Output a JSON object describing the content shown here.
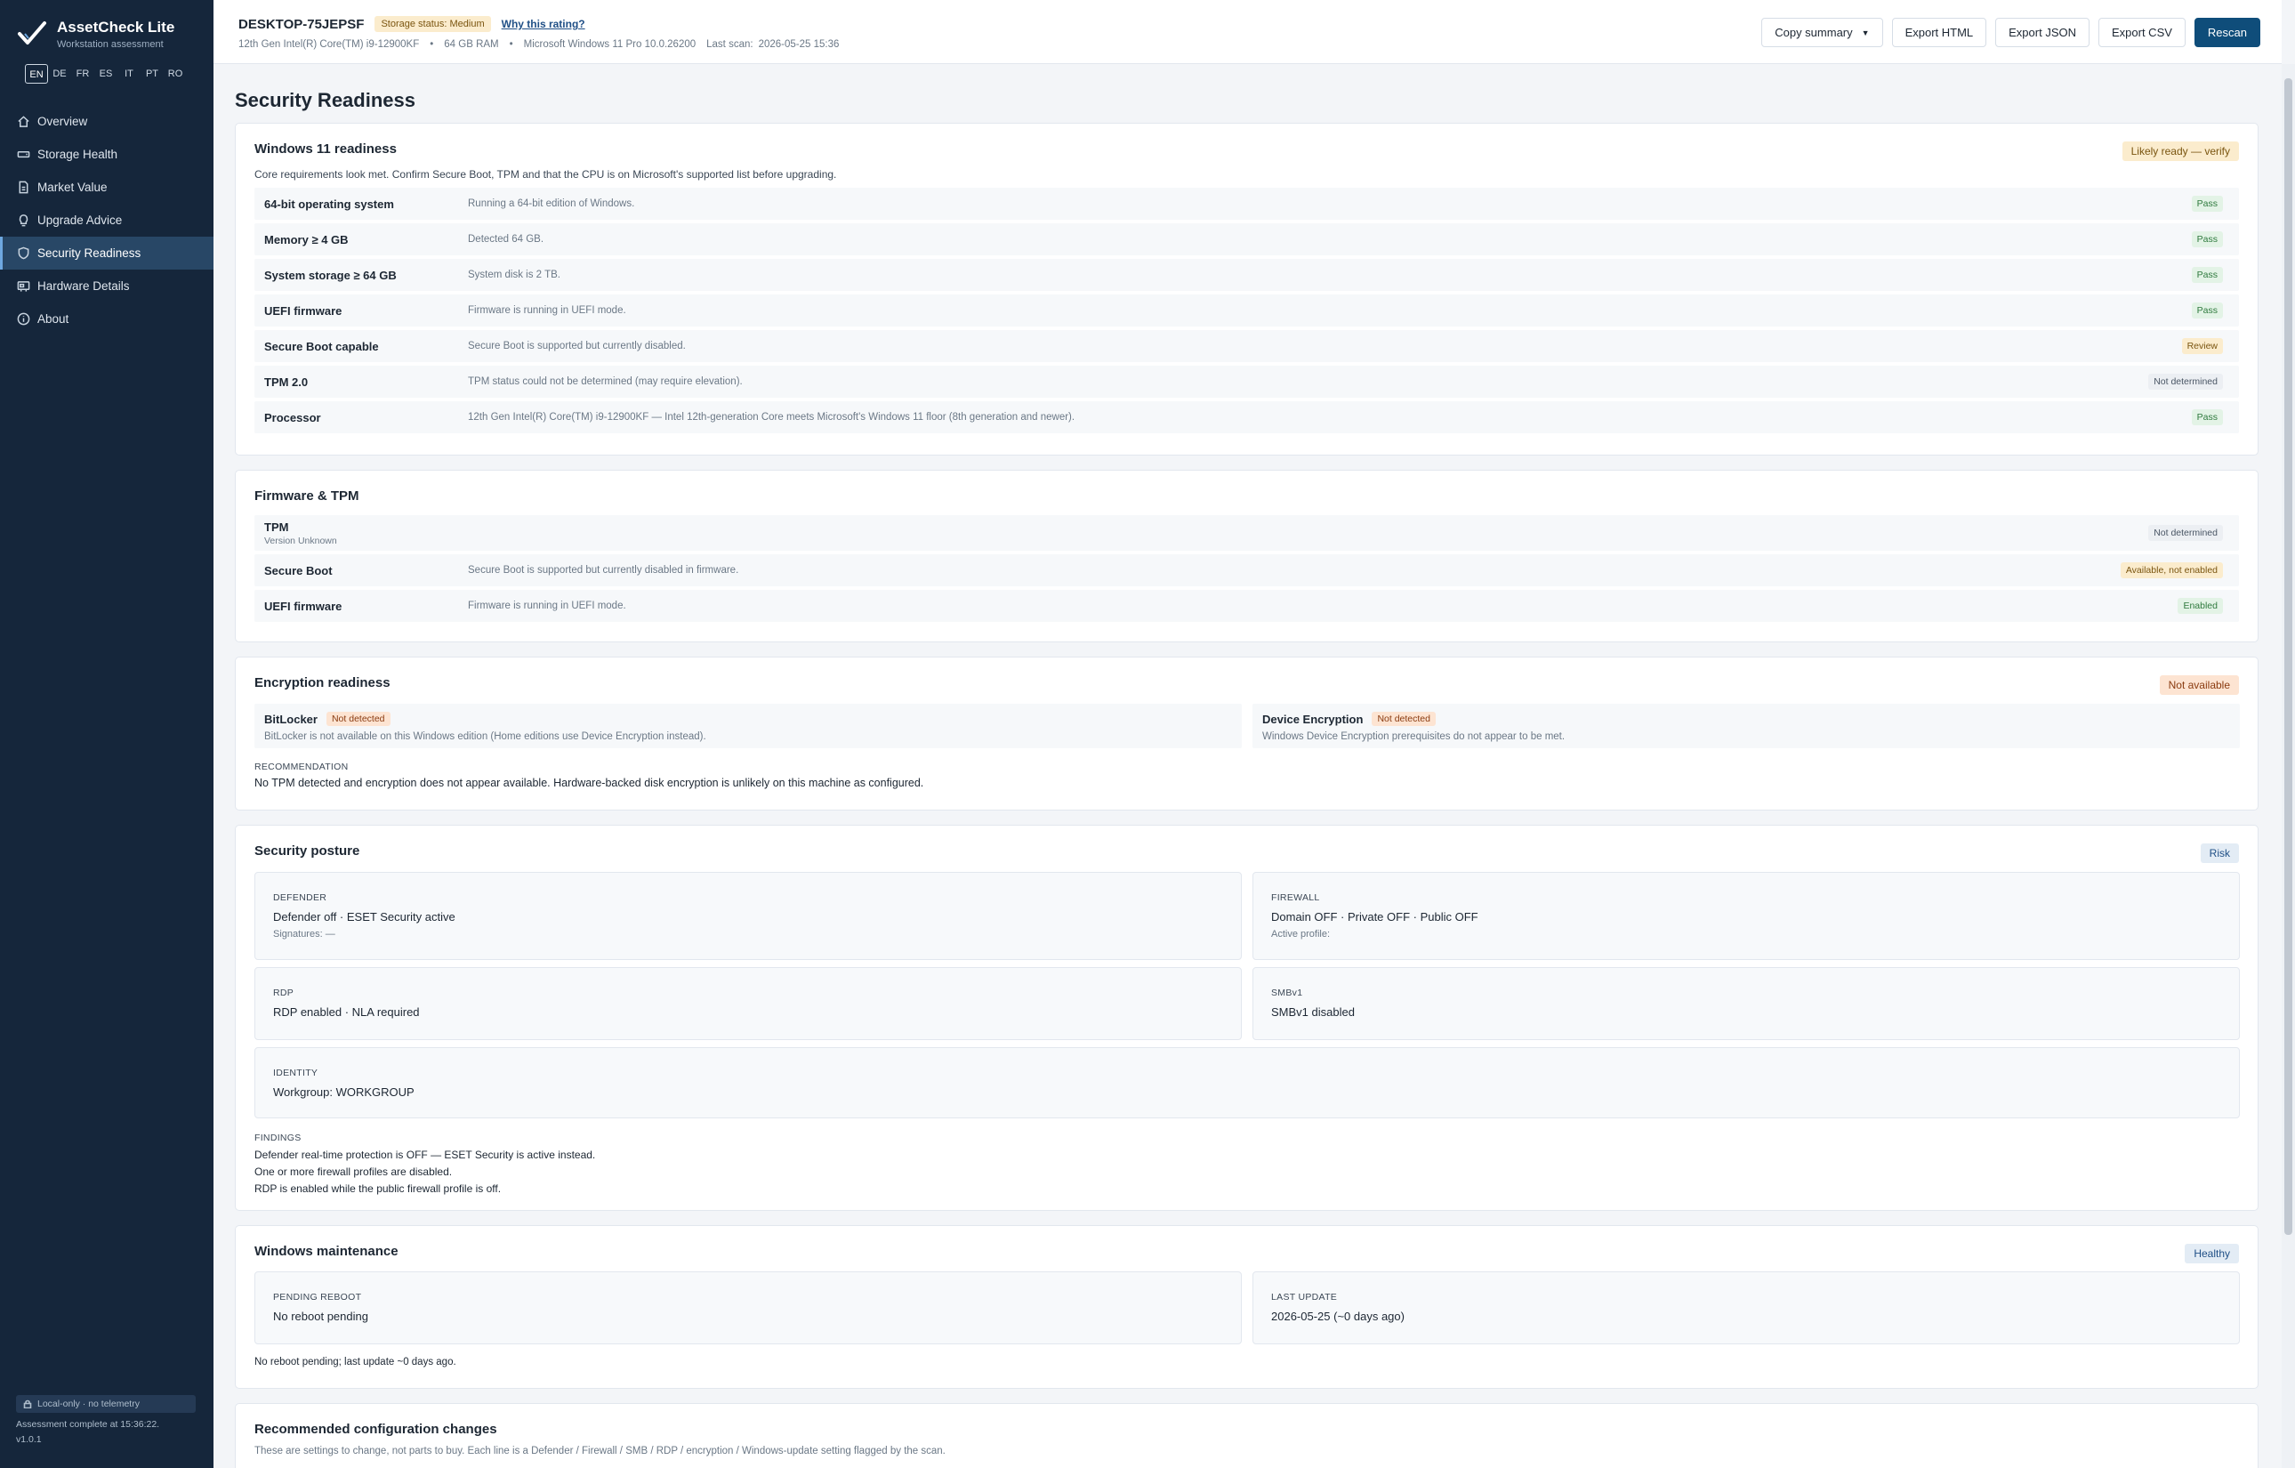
{
  "app": {
    "name": "AssetCheck Lite",
    "subtitle": "Workstation assessment"
  },
  "languages": [
    {
      "code": "EN",
      "active": true
    },
    {
      "code": "DE",
      "active": false
    },
    {
      "code": "FR",
      "active": false
    },
    {
      "code": "ES",
      "active": false
    },
    {
      "code": "IT",
      "active": false
    },
    {
      "code": "PT",
      "active": false
    },
    {
      "code": "RO",
      "active": false
    }
  ],
  "nav": [
    {
      "label": "Overview",
      "icon": "home-icon",
      "active": false
    },
    {
      "label": "Storage Health",
      "icon": "drive-icon",
      "active": false
    },
    {
      "label": "Market Value",
      "icon": "document-icon",
      "active": false
    },
    {
      "label": "Upgrade Advice",
      "icon": "lightbulb-icon",
      "active": false
    },
    {
      "label": "Security Readiness",
      "icon": "shield-icon",
      "active": true
    },
    {
      "label": "Hardware Details",
      "icon": "chip-icon",
      "active": false
    },
    {
      "label": "About",
      "icon": "info-icon",
      "active": false
    }
  ],
  "footer": {
    "local": "Local-only · no telemetry",
    "assessment": "Assessment complete at 15:36:22.",
    "version": "v1.0.1"
  },
  "header": {
    "host": "DESKTOP-75JEPSF",
    "storage_badge": "Storage status: Medium",
    "why_link": "Why this rating?",
    "cpu": "12th Gen Intel(R) Core(TM) i9-12900KF",
    "ram": "64 GB RAM",
    "os": "Microsoft Windows 11 Pro 10.0.26200",
    "sep": "•",
    "last_scan_label": "Last scan:",
    "last_scan": "2026-05-25 15:36",
    "buttons": {
      "copy": "Copy summary",
      "export_html": "Export HTML",
      "export_json": "Export JSON",
      "export_csv": "Export CSV",
      "rescan": "Rescan"
    }
  },
  "page_title": "Security Readiness",
  "win11": {
    "title": "Windows 11 readiness",
    "status": "Likely ready — verify",
    "subtitle": "Core requirements look met. Confirm Secure Boot, TPM and that the CPU is on Microsoft's supported list before upgrading.",
    "rows": [
      {
        "label": "64-bit operating system",
        "desc": "Running a 64-bit edition of Windows.",
        "result": "Pass",
        "kind": "pass"
      },
      {
        "label": "Memory ≥ 4 GB",
        "desc": "Detected 64 GB.",
        "result": "Pass",
        "kind": "pass"
      },
      {
        "label": "System storage ≥ 64 GB",
        "desc": "System disk is 2 TB.",
        "result": "Pass",
        "kind": "pass"
      },
      {
        "label": "UEFI firmware",
        "desc": "Firmware is running in UEFI mode.",
        "result": "Pass",
        "kind": "pass"
      },
      {
        "label": "Secure Boot capable",
        "desc": "Secure Boot is supported but currently disabled.",
        "result": "Review",
        "kind": "review"
      },
      {
        "label": "TPM 2.0",
        "desc": "TPM status could not be determined (may require elevation).",
        "result": "Not determined",
        "kind": "nd"
      },
      {
        "label": "Processor",
        "desc": "12th Gen Intel(R) Core(TM) i9-12900KF — Intel 12th-generation Core meets Microsoft's Windows 11 floor (8th generation and newer).",
        "result": "Pass",
        "kind": "pass"
      }
    ]
  },
  "firmware": {
    "title": "Firmware & TPM",
    "rows": [
      {
        "label": "TPM",
        "sublabel": "Version Unknown",
        "desc": "",
        "result": "Not determined",
        "kind": "nd"
      },
      {
        "label": "Secure Boot",
        "sublabel": "",
        "desc": "Secure Boot is supported but currently disabled in firmware.",
        "result": "Available, not enabled",
        "kind": "review"
      },
      {
        "label": "UEFI firmware",
        "sublabel": "",
        "desc": "Firmware is running in UEFI mode.",
        "result": "Enabled",
        "kind": "pass"
      }
    ]
  },
  "encryption": {
    "title": "Encryption readiness",
    "status": "Not available",
    "bitlocker": {
      "title": "BitLocker",
      "tag": "Not detected",
      "desc": "BitLocker is not available on this Windows edition (Home editions use Device Encryption instead)."
    },
    "device": {
      "title": "Device Encryption",
      "tag": "Not detected",
      "desc": "Windows Device Encryption prerequisites do not appear to be met."
    },
    "rec_label": "Recommendation",
    "rec_text": "No TPM detected and encryption does not appear available. Hardware-backed disk encryption is unlikely on this machine as configured."
  },
  "posture": {
    "title": "Security posture",
    "status": "Risk",
    "defender": {
      "key": "Defender",
      "value": "Defender off · ESET Security active",
      "sub": "Signatures: —"
    },
    "firewall": {
      "key": "Firewall",
      "value": "Domain OFF · Private OFF · Public OFF",
      "sub": "Active profile:"
    },
    "rdp": {
      "key": "RDP",
      "value": "RDP enabled · NLA required"
    },
    "smb": {
      "key": "SMBv1",
      "value": "SMBv1 disabled"
    },
    "identity": {
      "key": "Identity",
      "value": "Workgroup: WORKGROUP"
    },
    "findings_label": "Findings",
    "findings": [
      "Defender real-time protection is OFF — ESET Security is active instead.",
      "One or more firewall profiles are disabled.",
      "RDP is enabled while the public firewall profile is off."
    ]
  },
  "maintenance": {
    "title": "Windows maintenance",
    "status": "Healthy",
    "reboot": {
      "key": "Pending reboot",
      "value": "No reboot pending"
    },
    "update": {
      "key": "Last update",
      "value": "2026-05-25 (~0 days ago)"
    },
    "summary": "No reboot pending; last update ~0 days ago."
  },
  "recommended": {
    "title": "Recommended configuration changes",
    "subtitle": "These are settings to change, not parts to buy. Each line is a Defender / Firewall / SMB / RDP / encryption / Windows-update setting flagged by the scan."
  }
}
